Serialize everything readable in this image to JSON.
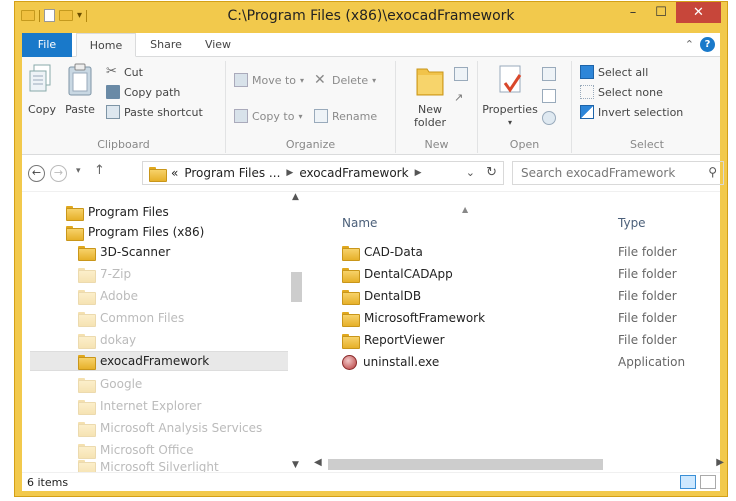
{
  "window": {
    "title": "C:\\Program Files (x86)\\exocadFramework",
    "minimize": "–",
    "maximize": "☐",
    "close": "✕"
  },
  "ribbon": {
    "tabs": [
      "File",
      "Home",
      "Share",
      "View"
    ],
    "help_icon": "?",
    "clipboard": {
      "copy": "Copy",
      "paste": "Paste",
      "cut": "Cut",
      "copy_path": "Copy path",
      "paste_shortcut": "Paste shortcut",
      "group": "Clipboard"
    },
    "organize": {
      "move_to": "Move to",
      "copy_to": "Copy to",
      "delete": "Delete",
      "rename": "Rename",
      "group": "Organize"
    },
    "new": {
      "new_folder_line1": "New",
      "new_folder_line2": "folder",
      "group": "New"
    },
    "open": {
      "properties": "Properties",
      "group": "Open"
    },
    "select": {
      "select_all": "Select all",
      "select_none": "Select none",
      "invert_selection": "Invert selection",
      "group": "Select"
    }
  },
  "address": {
    "overflow": "«",
    "crumbs": [
      "Program Files ...",
      "exocadFramework"
    ],
    "search_placeholder": "Search exocadFramework"
  },
  "nav_pane": {
    "items": [
      {
        "label": "Program Files",
        "level": 0,
        "state": "normal"
      },
      {
        "label": "Program Files (x86)",
        "level": 0,
        "state": "normal"
      },
      {
        "label": "3D-Scanner",
        "level": 1,
        "state": "normal"
      },
      {
        "label": "7-Zip",
        "level": 1,
        "state": "faded"
      },
      {
        "label": "Adobe",
        "level": 1,
        "state": "faded"
      },
      {
        "label": "Common Files",
        "level": 1,
        "state": "faded"
      },
      {
        "label": "dokay",
        "level": 1,
        "state": "faded"
      },
      {
        "label": "exocadFramework",
        "level": 1,
        "state": "selected"
      },
      {
        "label": "Google",
        "level": 1,
        "state": "faded"
      },
      {
        "label": "Internet Explorer",
        "level": 1,
        "state": "faded"
      },
      {
        "label": "Microsoft Analysis Services",
        "level": 1,
        "state": "faded"
      },
      {
        "label": "Microsoft Office",
        "level": 1,
        "state": "faded"
      },
      {
        "label": "Microsoft Silverlight",
        "level": 1,
        "state": "faded"
      }
    ]
  },
  "file_list": {
    "columns": {
      "name": "Name",
      "type": "Type"
    },
    "rows": [
      {
        "name": "CAD-Data",
        "type": "File folder",
        "icon": "folder-icon"
      },
      {
        "name": "DentalCADApp",
        "type": "File folder",
        "icon": "folder-icon"
      },
      {
        "name": "DentalDB",
        "type": "File folder",
        "icon": "folder-icon"
      },
      {
        "name": "MicrosoftFramework",
        "type": "File folder",
        "icon": "folder-icon"
      },
      {
        "name": "ReportViewer",
        "type": "File folder",
        "icon": "folder-icon"
      },
      {
        "name": "uninstall.exe",
        "type": "Application",
        "icon": "application-icon"
      }
    ]
  },
  "status": {
    "item_count": "6 items"
  }
}
